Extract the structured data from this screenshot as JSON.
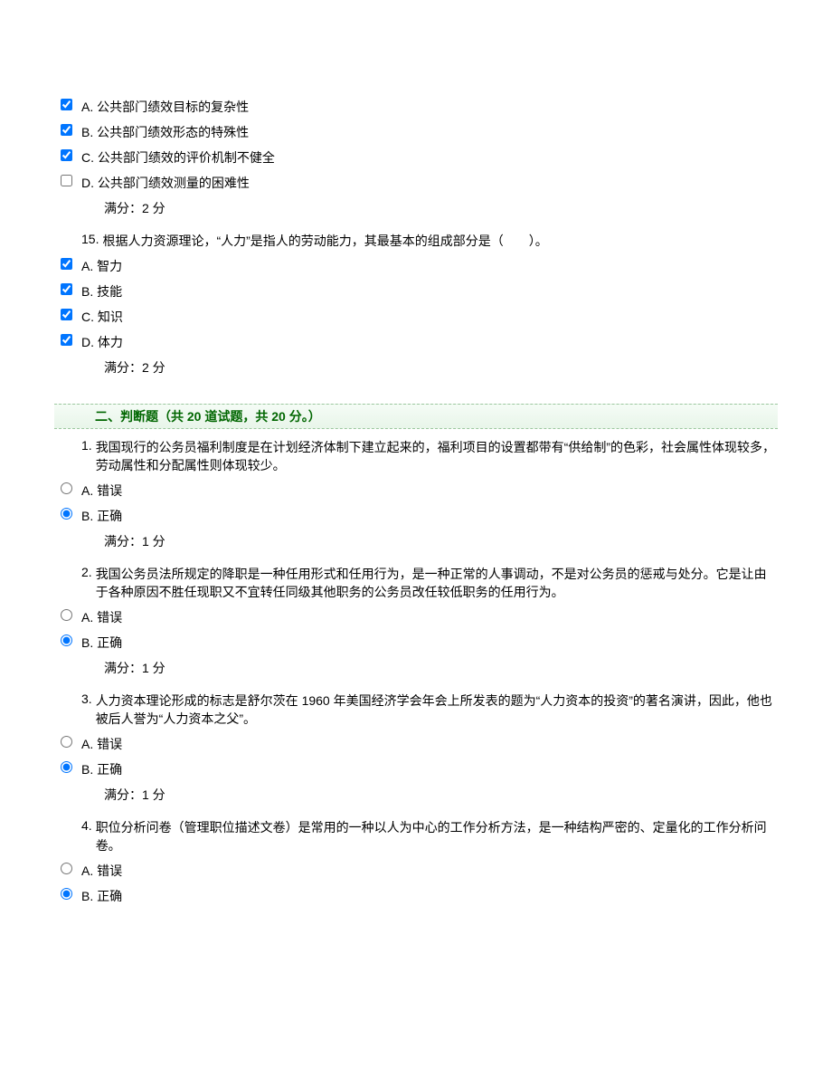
{
  "mc": {
    "q14": {
      "opts": {
        "a": "A. 公共部门绩效目标的复杂性",
        "b": "B. 公共部门绩效形态的特殊性",
        "c": "C. 公共部门绩效的评价机制不健全",
        "d": "D. 公共部门绩效测量的困难性"
      },
      "score": "满分：2 分"
    },
    "q15": {
      "num": "15. ",
      "text": "根据人力资源理论，“人力”是指人的劳动能力，其最基本的组成部分是（　　）。",
      "opts": {
        "a": "A. 智力",
        "b": "B. 技能",
        "c": "C. 知识",
        "d": "D. 体力"
      },
      "score": "满分：2 分"
    }
  },
  "section2": {
    "header": "二、判断题（共 20 道试题，共 20 分。）"
  },
  "tf": {
    "q1": {
      "num": "1. ",
      "text": "我国现行的公务员福利制度是在计划经济体制下建立起来的，福利项目的设置都带有“供给制”的色彩，社会属性体现较多，劳动属性和分配属性则体现较少。",
      "a": "A. 错误",
      "b": "B. 正确",
      "score": "满分：1 分"
    },
    "q2": {
      "num": "2. ",
      "text": "我国公务员法所规定的降职是一种任用形式和任用行为，是一种正常的人事调动，不是对公务员的惩戒与处分。它是让由于各种原因不胜任现职又不宜转任同级其他职务的公务员改任较低职务的任用行为。",
      "a": "A. 错误",
      "b": "B. 正确",
      "score": "满分：1 分"
    },
    "q3": {
      "num": "3. ",
      "text": "人力资本理论形成的标志是舒尔茨在 1960 年美国经济学会年会上所发表的题为“人力资本的投资”的著名演讲，因此，他也被后人誉为“人力资本之父”。",
      "a": "A. 错误",
      "b": "B. 正确",
      "score": "满分：1 分"
    },
    "q4": {
      "num": "4. ",
      "text": "职位分析问卷（管理职位描述文卷）是常用的一种以人为中心的工作分析方法，是一种结构严密的、定量化的工作分析问卷。",
      "a": "A. 错误",
      "b": "B. 正确"
    }
  }
}
